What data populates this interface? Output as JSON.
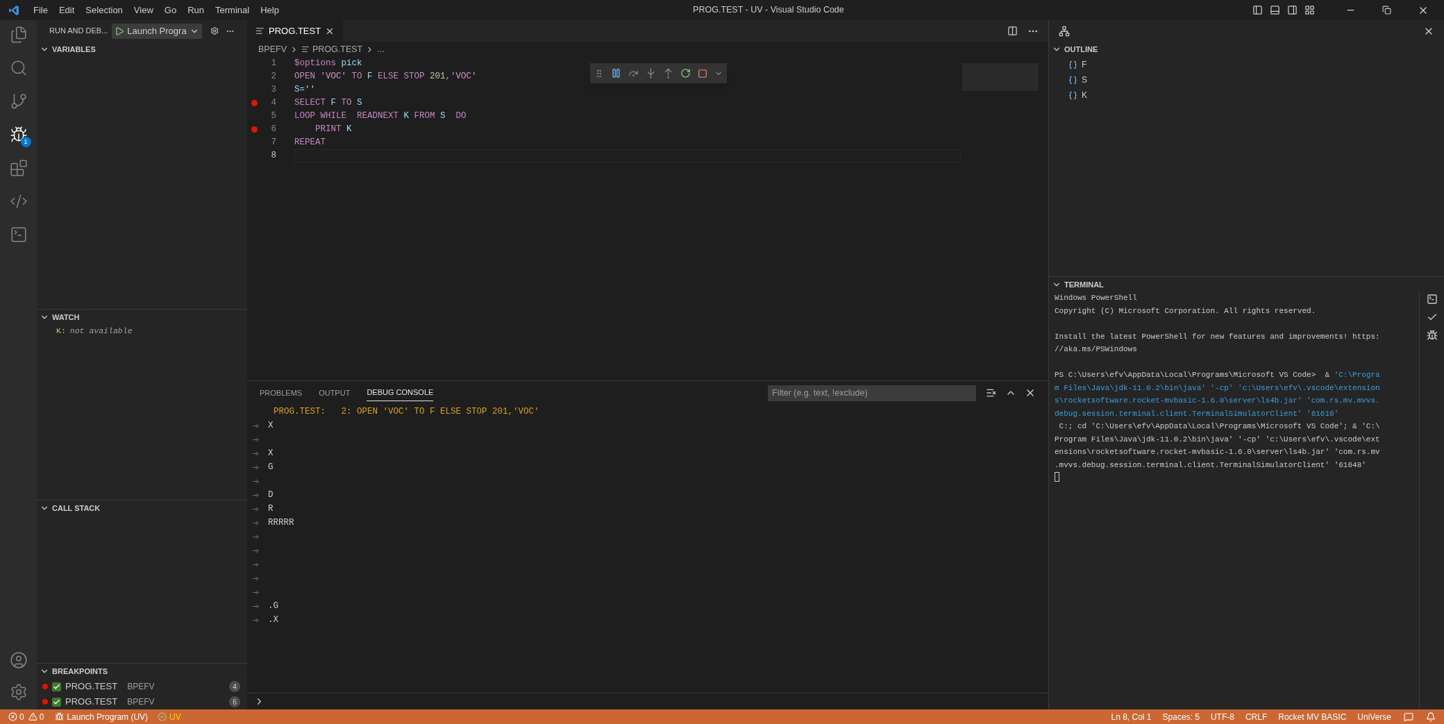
{
  "window": {
    "title": "PROG.TEST - UV - Visual Studio Code",
    "menu": [
      "File",
      "Edit",
      "Selection",
      "View",
      "Go",
      "Run",
      "Terminal",
      "Help"
    ]
  },
  "activity_bar": {
    "debug_badge": "1"
  },
  "sidebar": {
    "title": "RUN AND DEB...",
    "launch_config": "Launch Progra",
    "variables": {
      "title": "VARIABLES"
    },
    "watch": {
      "title": "WATCH",
      "items": [
        {
          "name": "K:",
          "value": "not available"
        }
      ]
    },
    "call_stack": {
      "title": "CALL STACK"
    },
    "breakpoints": {
      "title": "BREAKPOINTS",
      "items": [
        {
          "file": "PROG.TEST",
          "folder": "BPEFV",
          "line": "4",
          "checked": true
        },
        {
          "file": "PROG.TEST",
          "folder": "BPEFV",
          "line": "6",
          "checked": true
        }
      ]
    }
  },
  "editor": {
    "tab": "PROG.TEST",
    "breadcrumb": [
      "BPEFV",
      "PROG.TEST",
      "..."
    ],
    "lines": [
      {
        "number": "1",
        "breakpoint": false,
        "current": false,
        "tokens": [
          {
            "text": "$options",
            "kind": "keyword"
          },
          {
            "text": " pick",
            "kind": "variable"
          }
        ]
      },
      {
        "number": "2",
        "breakpoint": false,
        "current": false,
        "tokens": [
          {
            "text": "OPEN ",
            "kind": "keyword"
          },
          {
            "text": "'VOC' ",
            "kind": "string"
          },
          {
            "text": "TO ",
            "kind": "keyword"
          },
          {
            "text": "F ",
            "kind": "variable"
          },
          {
            "text": "ELSE STOP ",
            "kind": "keyword"
          },
          {
            "text": "201",
            "kind": "number"
          },
          {
            "text": ",",
            "kind": "keyword"
          },
          {
            "text": "'VOC'",
            "kind": "string"
          }
        ]
      },
      {
        "number": "3",
        "breakpoint": false,
        "current": false,
        "tokens": [
          {
            "text": "S=''",
            "kind": "variable"
          }
        ]
      },
      {
        "number": "4",
        "breakpoint": true,
        "current": false,
        "tokens": [
          {
            "text": "SELECT ",
            "kind": "keyword"
          },
          {
            "text": "F ",
            "kind": "variable"
          },
          {
            "text": "TO ",
            "kind": "keyword"
          },
          {
            "text": "S",
            "kind": "variable"
          }
        ]
      },
      {
        "number": "5",
        "breakpoint": false,
        "current": false,
        "tokens": [
          {
            "text": "LOOP WHILE  READNEXT ",
            "kind": "keyword"
          },
          {
            "text": "K ",
            "kind": "variable"
          },
          {
            "text": "FROM ",
            "kind": "keyword"
          },
          {
            "text": "S  ",
            "kind": "variable"
          },
          {
            "text": "DO",
            "kind": "keyword"
          }
        ]
      },
      {
        "number": "6",
        "breakpoint": true,
        "current": false,
        "tokens": [
          {
            "text": "    PRINT ",
            "kind": "keyword"
          },
          {
            "text": "K",
            "kind": "variable"
          }
        ]
      },
      {
        "number": "7",
        "breakpoint": false,
        "current": false,
        "tokens": [
          {
            "text": "REPEAT",
            "kind": "keyword"
          }
        ]
      },
      {
        "number": "8",
        "breakpoint": false,
        "current": true
      }
    ]
  },
  "panel": {
    "tabs": [
      {
        "label": "PROBLEMS",
        "selected": false
      },
      {
        "label": "OUTPUT",
        "selected": false
      },
      {
        "label": "DEBUG CONSOLE",
        "selected": true
      }
    ],
    "filter": {
      "placeholder": "Filter (e.g. text, !exclude)"
    },
    "console": [
      {
        "kind": "location",
        "text": "PROG.TEST:   2: OPEN 'VOC' TO F ELSE STOP 201,'VOC'"
      },
      {
        "kind": "output",
        "text": "X"
      },
      {
        "kind": "empty"
      },
      {
        "kind": "output",
        "text": "X"
      },
      {
        "kind": "output",
        "text": "G"
      },
      {
        "kind": "empty"
      },
      {
        "kind": "output",
        "text": "D"
      },
      {
        "kind": "output",
        "text": "R"
      },
      {
        "kind": "output",
        "text": "RRRRR"
      },
      {
        "kind": "empty"
      },
      {
        "kind": "empty"
      },
      {
        "kind": "empty"
      },
      {
        "kind": "empty"
      },
      {
        "kind": "empty"
      },
      {
        "kind": "output",
        "text": ".G"
      },
      {
        "kind": "output",
        "text": ".X"
      }
    ]
  },
  "outline": {
    "title": "OUTLINE",
    "items": [
      {
        "name": "F"
      },
      {
        "name": "S"
      },
      {
        "name": "K"
      }
    ]
  },
  "terminal": {
    "title": "TERMINAL",
    "lines": [
      {
        "kind": "text",
        "segments": [
          {
            "text": "Windows PowerShell",
            "kind": "plain"
          }
        ]
      },
      {
        "kind": "text",
        "segments": [
          {
            "text": "Copyright (C) Microsoft Corporation. All rights reserved.",
            "kind": "plain"
          }
        ]
      },
      {
        "kind": "blank"
      },
      {
        "kind": "text",
        "segments": [
          {
            "text": "Install the latest PowerShell for new features and improvements! https:",
            "kind": "plain"
          }
        ]
      },
      {
        "kind": "text",
        "segments": [
          {
            "text": "//aka.ms/PSWindows",
            "kind": "plain"
          }
        ]
      },
      {
        "kind": "blank"
      },
      {
        "kind": "text",
        "segments": [
          {
            "text": "PS C:\\Users\\efv\\AppData\\Local\\Programs\\Microsoft VS Code>  & ",
            "kind": "plain"
          },
          {
            "text": "'C:\\Progra",
            "kind": "path"
          }
        ]
      },
      {
        "kind": "text",
        "segments": [
          {
            "text": "m Files\\Java\\jdk-11.0.2\\bin\\java' '-cp' 'c:\\Users\\efv\\.vscode\\extension",
            "kind": "path"
          }
        ]
      },
      {
        "kind": "text",
        "segments": [
          {
            "text": "s\\rocketsoftware.rocket-mvbasic-1.6.0\\server\\ls4b.jar' 'com.rs.mv.mvvs.",
            "kind": "path"
          }
        ]
      },
      {
        "kind": "text",
        "segments": [
          {
            "text": "debug.session.terminal.client.TerminalSimulatorClient' '61610'",
            "kind": "path"
          }
        ]
      },
      {
        "kind": "text",
        "segments": [
          {
            "text": " C:; cd 'C:\\Users\\efv\\AppData\\Local\\Programs\\Microsoft VS Code'; & 'C:\\",
            "kind": "plain"
          }
        ]
      },
      {
        "kind": "text",
        "segments": [
          {
            "text": "Program Files\\Java\\jdk-11.0.2\\bin\\java' '-cp' 'c:\\Users\\efv\\.vscode\\ext",
            "kind": "plain"
          }
        ]
      },
      {
        "kind": "text",
        "segments": [
          {
            "text": "ensions\\rocketsoftware.rocket-mvbasic-1.6.0\\server\\ls4b.jar' 'com.rs.mv",
            "kind": "plain"
          }
        ]
      },
      {
        "kind": "text",
        "segments": [
          {
            "text": ".mvvs.debug.session.terminal.client.TerminalSimulatorClient' '61648'",
            "kind": "plain"
          }
        ]
      }
    ]
  },
  "status_bar": {
    "errors": "0",
    "warnings": "0",
    "launch": "Launch Program (UV)",
    "profile": "UV",
    "right": [
      "Ln 8, Col 1",
      "Spaces: 5",
      "UTF-8",
      "CRLF",
      "Rocket MV BASIC",
      "UniVerse"
    ]
  }
}
